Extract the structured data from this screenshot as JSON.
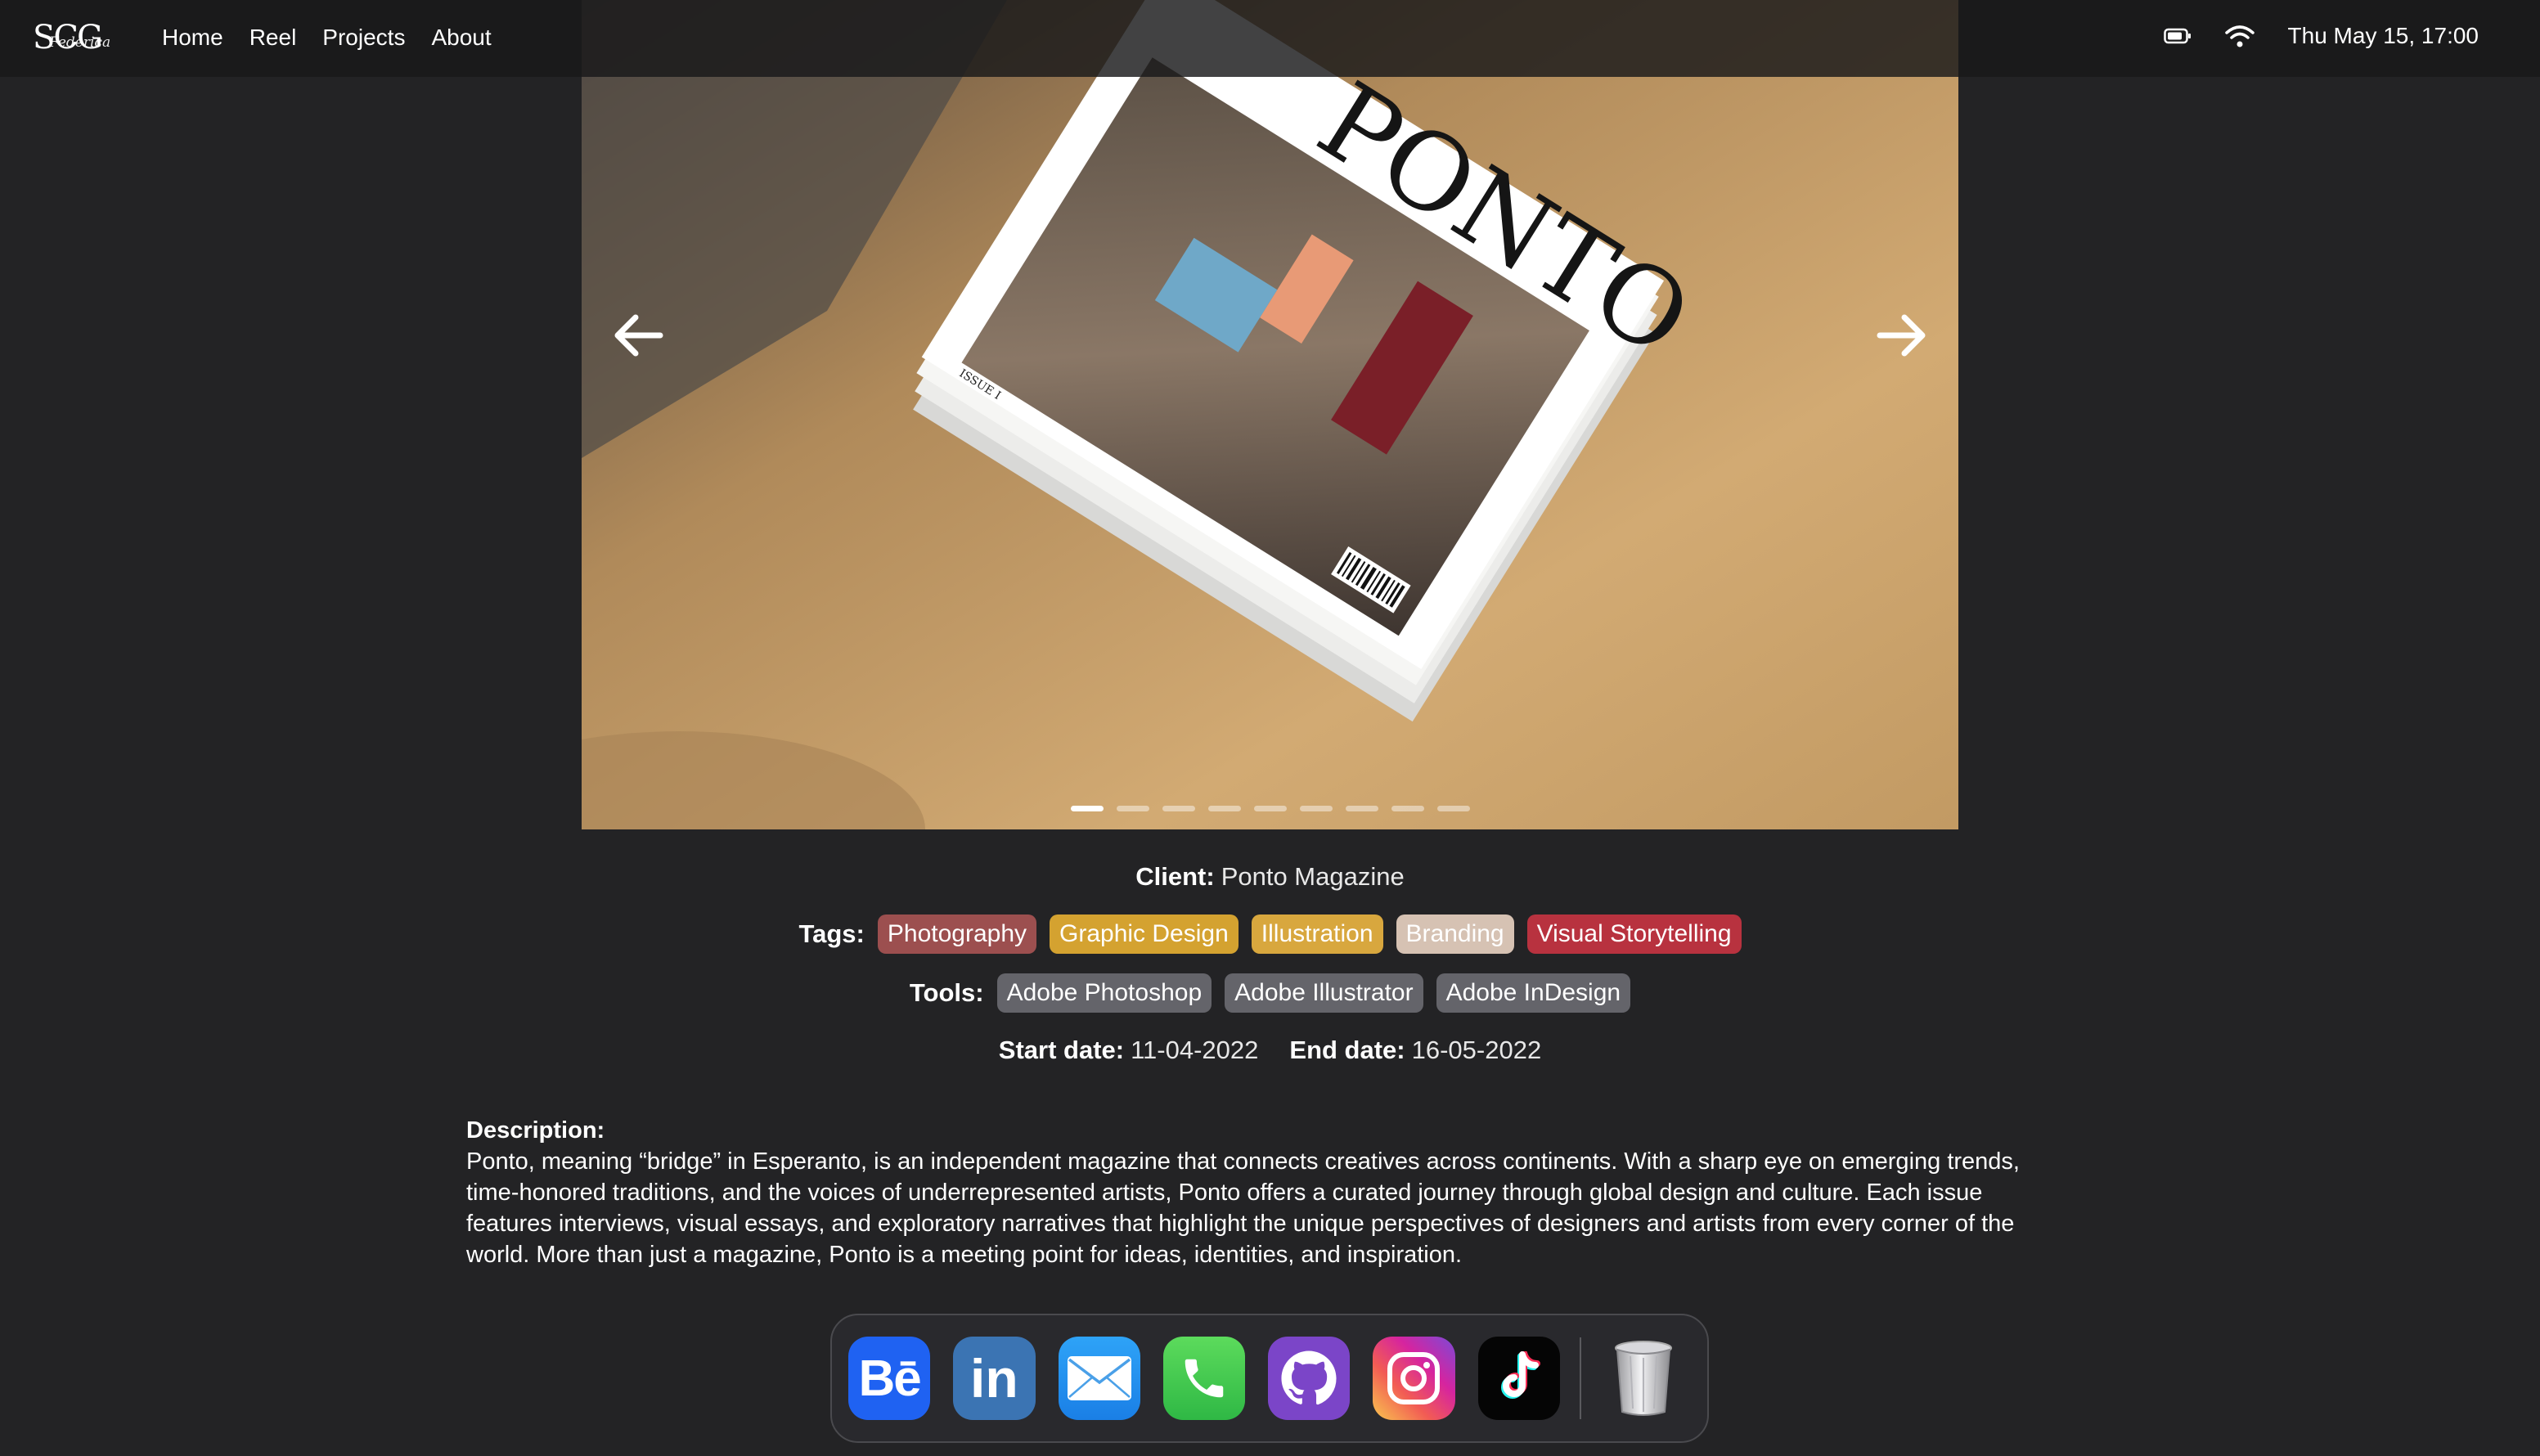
{
  "topbar": {
    "logo": "SCG",
    "logo_signature": "Federica",
    "nav": [
      "Home",
      "Reel",
      "Projects",
      "About"
    ],
    "clock": "Thu May 15, 17:00",
    "icons": [
      "battery-icon",
      "wifi-icon"
    ]
  },
  "carousel": {
    "magazine_title": "PONTO",
    "issue_label": "ISSUE I",
    "slide_count": 9,
    "active_slide": 1,
    "prev_icon": "arrow-left-icon",
    "next_icon": "arrow-right-icon"
  },
  "project": {
    "client_label": "Client:",
    "client": "Ponto Magazine",
    "tags_label": "Tags:",
    "tags": [
      {
        "label": "Photography",
        "color": "#9c4f4f"
      },
      {
        "label": "Graphic Design",
        "color": "#d4a230"
      },
      {
        "label": "Illustration",
        "color": "#d8a73e"
      },
      {
        "label": "Branding",
        "color": "#d6c2b3"
      },
      {
        "label": "Visual Storytelling",
        "color": "#b8323f"
      }
    ],
    "tools_label": "Tools:",
    "tools": [
      "Adobe Photoshop",
      "Adobe Illustrator",
      "Adobe InDesign"
    ],
    "start_label": "Start date:",
    "start_date": "11-04-2022",
    "end_label": "End date:",
    "end_date": "16-05-2022",
    "description_label": "Description:",
    "description": "Ponto, meaning “bridge” in Esperanto, is an independent magazine that connects creatives across continents. With a sharp eye on emerging trends, time-honored traditions, and the voices of underrepresented artists, Ponto offers a curated journey through global design and culture. Each issue features interviews, visual essays, and exploratory narratives that highlight the unique perspectives of designers and artists from every corner of the world. More than just a magazine, Ponto is a meeting point for ideas, identities, and inspiration."
  },
  "dock": {
    "apps": [
      "behance-icon",
      "linkedin-icon",
      "mail-icon",
      "phone-icon",
      "github-icon",
      "instagram-icon",
      "tiktok-icon",
      "trash-icon"
    ],
    "behance_text": "Bē",
    "linkedin_text": "in"
  }
}
